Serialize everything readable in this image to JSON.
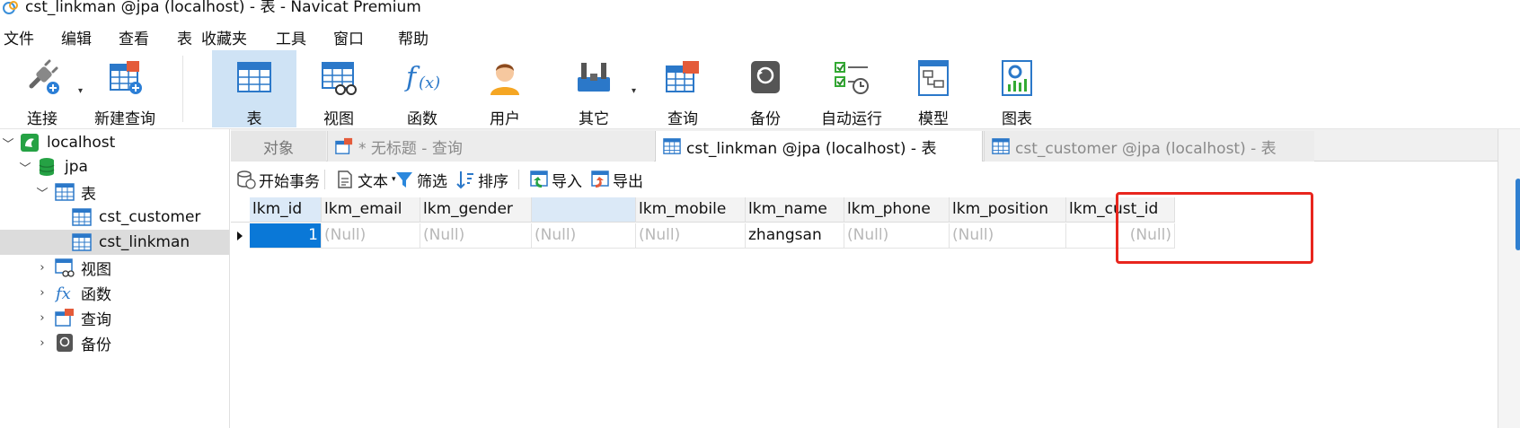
{
  "window": {
    "title": "cst_linkman @jpa (localhost) - 表 - Navicat Premium"
  },
  "menu": [
    "文件",
    "编辑",
    "查看",
    "表",
    "收藏夹",
    "工具",
    "窗口",
    "帮助"
  ],
  "toolbar": {
    "connect": "连接",
    "new_query": "新建查询",
    "table": "表",
    "view": "视图",
    "function": "函数",
    "user": "用户",
    "other": "其它",
    "query": "查询",
    "backup": "备份",
    "automation": "自动运行",
    "model": "模型",
    "chart": "图表"
  },
  "tree": {
    "connection": "localhost",
    "database": "jpa",
    "tables_group": "表",
    "tables": [
      "cst_customer",
      "cst_linkman"
    ],
    "views": "视图",
    "functions": "函数",
    "queries": "查询",
    "backups": "备份"
  },
  "tabs": {
    "objects": "对象",
    "untitled_query": "* 无标题 - 查询",
    "linkman_tab": "cst_linkman @jpa (localhost) - 表",
    "customer_tab": "cst_customer @jpa (localhost) - 表"
  },
  "subtoolbar": {
    "begin_transaction": "开始事务",
    "text": "文本",
    "filter": "筛选",
    "sort": "排序",
    "import": "导入",
    "export": "导出"
  },
  "grid": {
    "columns": [
      "lkm_id",
      "lkm_email",
      "lkm_gender",
      "",
      "lkm_mobile",
      "lkm_name",
      "lkm_phone",
      "lkm_position",
      "lkm_cust_id"
    ],
    "rows": [
      [
        "1",
        "(Null)",
        "(Null)",
        "(Null)",
        "(Null)",
        "zhangsan",
        "(Null)",
        "(Null)",
        "(Null)"
      ]
    ]
  },
  "colors": {
    "accent": "#0a78d7",
    "highlight_box": "#e8261e",
    "active_tool": "#cfe3f5"
  }
}
